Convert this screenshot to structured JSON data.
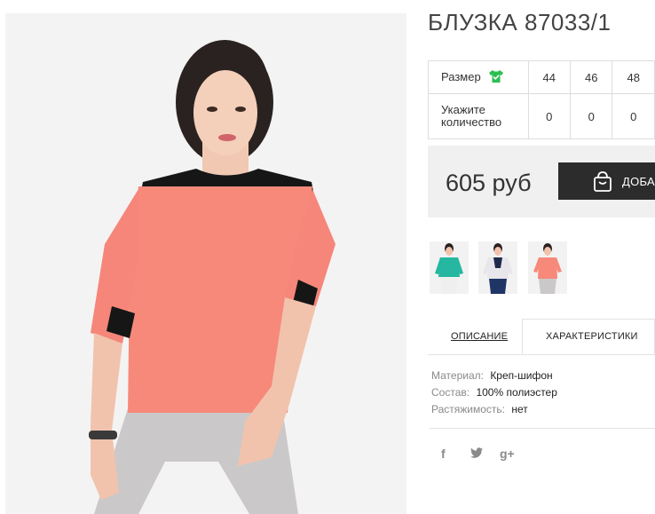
{
  "product": {
    "title": "БЛУЗКА 87033/1",
    "size_label": "Размер",
    "sizes": [
      "44",
      "46",
      "48"
    ],
    "qty_label_line1": "Укажите",
    "qty_label_line2": "количество",
    "quantities": [
      "0",
      "0",
      "0"
    ]
  },
  "purchase": {
    "price": "605 руб",
    "add_label": "ДОБАВ"
  },
  "tabs": {
    "description": "ОПИСАНИЕ",
    "characteristics": "ХАРАКТЕРИСТИКИ"
  },
  "specs": [
    {
      "key": "Материал:",
      "value": "Креп-шифон"
    },
    {
      "key": "Состав:",
      "value": "100% полиэстер"
    },
    {
      "key": "Растяжимость:",
      "value": "нет"
    }
  ],
  "social": {
    "facebook": "f",
    "twitter": "t",
    "gplus": "g+"
  },
  "icons": {
    "size_chart": "tshirt-check-icon",
    "add": "shopping-bag-icon"
  },
  "colors": {
    "accent": "#2c2c2c",
    "tshirt_icon": "#2bbf4f",
    "price_bg": "#f0f0f0",
    "blouse": "#f7897a"
  }
}
